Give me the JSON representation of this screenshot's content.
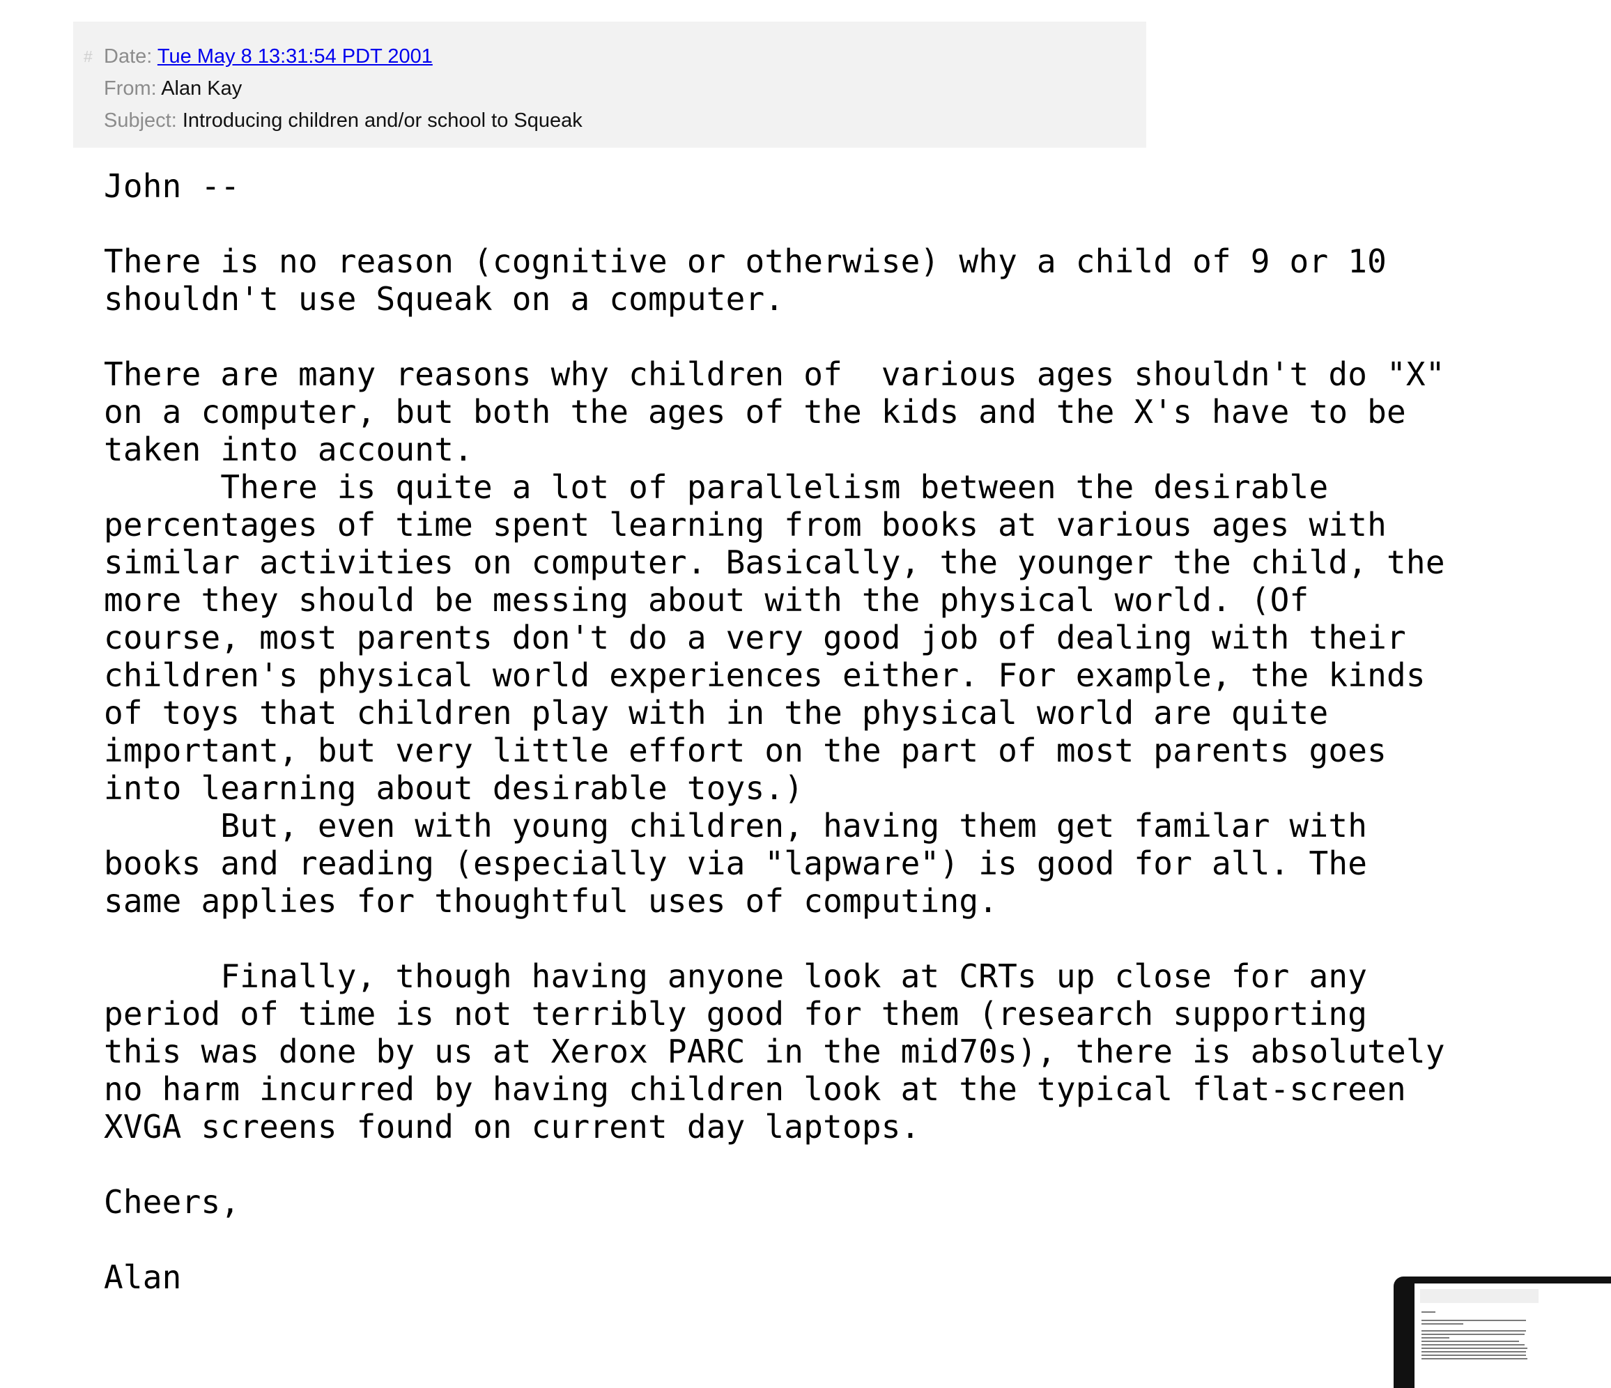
{
  "header": {
    "anchor": "#",
    "date_label": "Date:",
    "date_value": "Tue May 8 13:31:54 PDT 2001",
    "from_label": "From:",
    "from_value": "Alan Kay",
    "subject_label": "Subject:",
    "subject_value": "Introducing children and/or school to Squeak"
  },
  "message": {
    "body": "John --\n\nThere is no reason (cognitive or otherwise) why a child of 9 or 10\nshouldn't use Squeak on a computer.\n\nThere are many reasons why children of  various ages shouldn't do \"X\"\non a computer, but both the ages of the kids and the X's have to be\ntaken into account.\n      There is quite a lot of parallelism between the desirable\npercentages of time spent learning from books at various ages with\nsimilar activities on computer. Basically, the younger the child, the\nmore they should be messing about with the physical world. (Of\ncourse, most parents don't do a very good job of dealing with their\nchildren's physical world experiences either. For example, the kinds\nof toys that children play with in the physical world are quite\nimportant, but very little effort on the part of most parents goes\ninto learning about desirable toys.)\n      But, even with young children, having them get familar with\nbooks and reading (especially via \"lapware\") is good for all. The\nsame applies for thoughtful uses of computing.\n\n      Finally, though having anyone look at CRTs up close for any\nperiod of time is not terribly good for them (research supporting\nthis was done by us at Xerox PARC in the mid70s), there is absolutely\nno harm incurred by having children look at the typical flat-screen\nXVGA screens found on current day laptops.\n\nCheers,\n\nAlan"
  }
}
